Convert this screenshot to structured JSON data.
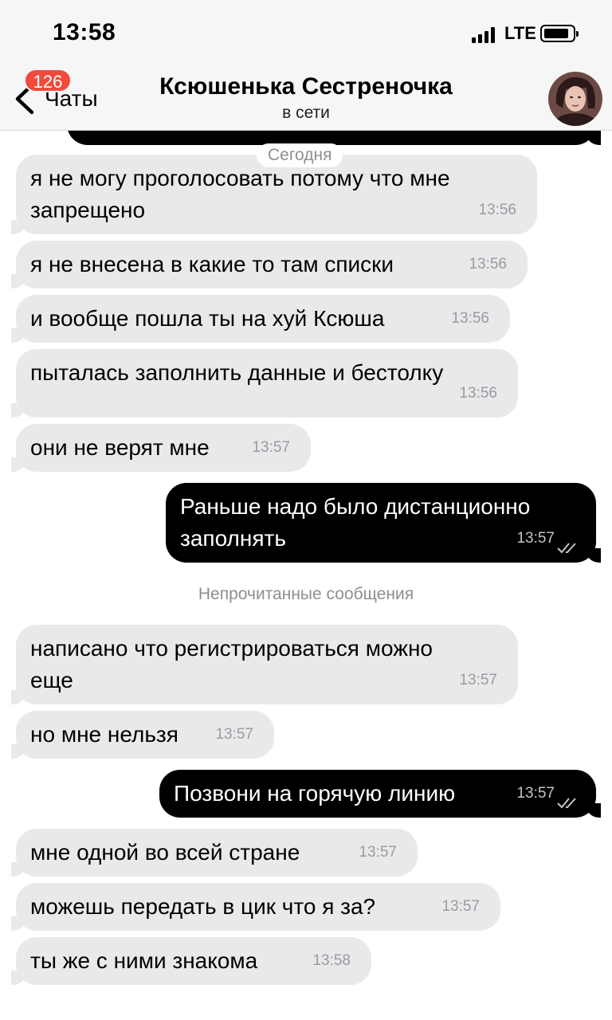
{
  "status_bar": {
    "time": "13:58",
    "network": "LTE"
  },
  "header": {
    "back_label": "Чаты",
    "unread_count": "126",
    "title": "Ксюшенька Сестреночка",
    "subtitle": "в сети"
  },
  "date_divider": "Сегодня",
  "unread_divider": "Непрочитанные сообщения",
  "messages": [
    {
      "dir": "in",
      "text_lines": [
        "я не могу проголосовать потому что мне",
        "запрещено"
      ],
      "time": "13:56"
    },
    {
      "dir": "in",
      "text_lines": [
        "я не внесена в какие то там списки"
      ],
      "time": "13:56"
    },
    {
      "dir": "in",
      "text_lines": [
        "и вообще пошла ты на хуй Ксюша"
      ],
      "time": "13:56"
    },
    {
      "dir": "in",
      "text_lines": [
        "пыталась заполнить данные и бестолку"
      ],
      "time": "13:56"
    },
    {
      "dir": "in",
      "text_lines": [
        "они не верят мне"
      ],
      "time": "13:57"
    },
    {
      "dir": "out",
      "text_lines": [
        "Раньше надо было дистанционно",
        "заполнять"
      ],
      "time": "13:57",
      "read": true
    },
    {
      "dir": "in",
      "text_lines": [
        "написано что регистрироваться можно",
        "еще"
      ],
      "time": "13:57"
    },
    {
      "dir": "in",
      "text_lines": [
        "но мне нельзя"
      ],
      "time": "13:57"
    },
    {
      "dir": "out",
      "text_lines": [
        "Позвони на горячую линию"
      ],
      "time": "13:57",
      "read": true
    },
    {
      "dir": "in",
      "text_lines": [
        "мне одной во всей стране"
      ],
      "time": "13:57"
    },
    {
      "dir": "in",
      "text_lines": [
        "можешь передать в цик что я за?"
      ],
      "time": "13:57"
    },
    {
      "dir": "in",
      "text_lines": [
        "ты же с ними знакома"
      ],
      "time": "13:58"
    }
  ],
  "colors": {
    "incoming_bubble": "#e9e9eb",
    "outgoing_bubble": "#000000",
    "badge": "#f24a3c",
    "header_bg": "#f6f6f7"
  },
  "icons": [
    "signal-icon",
    "battery-icon",
    "back-chevron-icon",
    "double-check-icon",
    "avatar"
  ]
}
